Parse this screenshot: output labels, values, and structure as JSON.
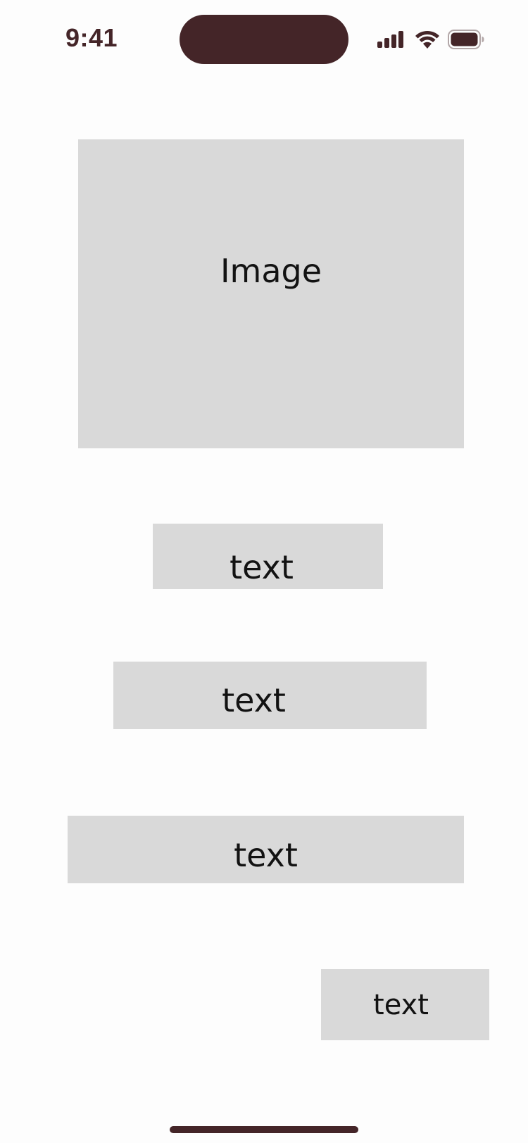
{
  "status_bar": {
    "time": "9:41",
    "icons": [
      "signal-icon",
      "wifi-icon",
      "battery-icon"
    ]
  },
  "content": {
    "image_label": "Image",
    "text_blocks": [
      "text",
      "text",
      "text",
      "text"
    ]
  },
  "colors": {
    "accent": "#442528",
    "placeholder": "#d9d9d9",
    "background": "#fdfdfd",
    "text": "#121212"
  }
}
